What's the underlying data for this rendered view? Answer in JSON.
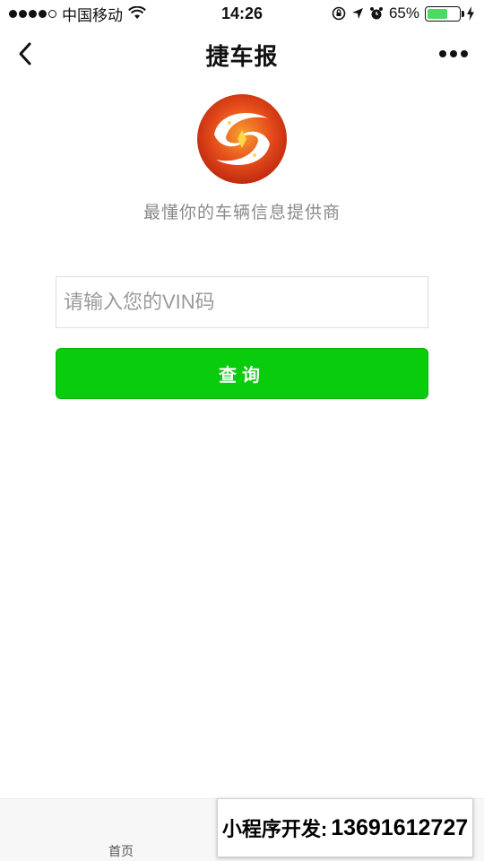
{
  "status_bar": {
    "carrier": "中国移动",
    "time": "14:26",
    "battery_percent": "65%",
    "battery_level": 0.65
  },
  "nav": {
    "title": "捷车报"
  },
  "main": {
    "tagline": "最懂你的车辆信息提供商",
    "vin_placeholder": "请输入您的VIN码",
    "query_label": "查询"
  },
  "tab_bar": {
    "home_label": "首页",
    "second_label": ""
  },
  "promo": {
    "label": "小程序开发:",
    "phone": "13691612727"
  },
  "colors": {
    "button_green": "#09cc0c",
    "battery_green": "#4cd964",
    "logo_orange": "#e8501c"
  },
  "icons": {
    "back": "chevron-left-icon",
    "more": "more-dots-icon",
    "wifi": "wifi-icon",
    "location": "location-arrow-icon",
    "alarm": "alarm-icon",
    "lock_rotation": "rotation-lock-icon",
    "charging": "charging-bolt-icon"
  }
}
